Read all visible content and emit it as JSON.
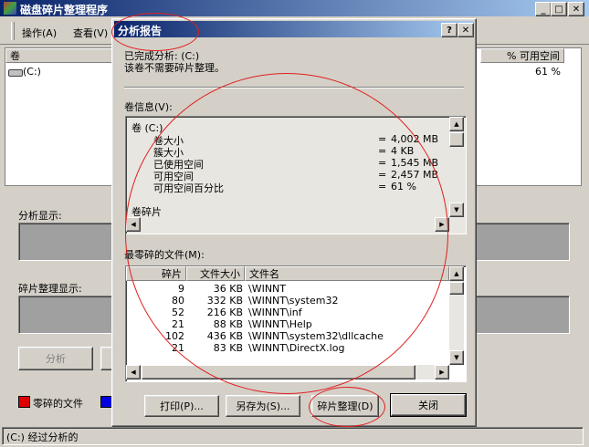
{
  "main_window": {
    "title": "磁盘碎片整理程序",
    "menu": [
      "操作(A)",
      "查看(V)"
    ],
    "columns": {
      "volume": "卷",
      "free_pct": "% 可用空间"
    },
    "volume_row": {
      "name": "(C:)",
      "free_pct": "61 %"
    },
    "analysis_label": "分析显示:",
    "defrag_label": "碎片整理显示:",
    "analyze_button": "分析",
    "legend_fragmented": "零碎的文件",
    "status_text": "(C:) 经过分析的"
  },
  "dialog": {
    "title": "分析报告",
    "help_glyph": "?",
    "close_glyph": "✕",
    "message_line1": "已完成分析: (C:)",
    "message_line2": "该卷不需要碎片整理。",
    "volume_info_label": "卷信息(V):",
    "volume_info": {
      "heading": "卷 (C:)",
      "rows": [
        {
          "label": "卷大小",
          "eq": "=",
          "value": "4,002 MB"
        },
        {
          "label": "簇大小",
          "eq": "=",
          "value": "4 KB"
        },
        {
          "label": "已使用空间",
          "eq": "=",
          "value": "1,545 MB"
        },
        {
          "label": "可用空间",
          "eq": "=",
          "value": "2,457 MB"
        },
        {
          "label": "可用空间百分比",
          "eq": "=",
          "value": "61 %"
        }
      ],
      "section2": "卷碎片"
    },
    "files_label": "最零碎的文件(M):",
    "files_columns": [
      "碎片",
      "文件大小",
      "文件名"
    ],
    "files": [
      {
        "frags": "9",
        "size": "36 KB",
        "name": "\\WINNT"
      },
      {
        "frags": "80",
        "size": "332 KB",
        "name": "\\WINNT\\system32"
      },
      {
        "frags": "52",
        "size": "216 KB",
        "name": "\\WINNT\\inf"
      },
      {
        "frags": "21",
        "size": "88 KB",
        "name": "\\WINNT\\Help"
      },
      {
        "frags": "102",
        "size": "436 KB",
        "name": "\\WINNT\\system32\\dllcache"
      },
      {
        "frags": "21",
        "size": "83 KB",
        "name": "\\WINNT\\DirectX.log"
      }
    ],
    "buttons": {
      "print": "打印(P)...",
      "save_as": "另存为(S)...",
      "defrag": "碎片整理(D)",
      "close": "关闭"
    }
  },
  "colors": {
    "fragmented": "#e00000",
    "contiguous": "#0000e0",
    "title_start": "#0a246a",
    "title_end": "#a6caf0"
  }
}
